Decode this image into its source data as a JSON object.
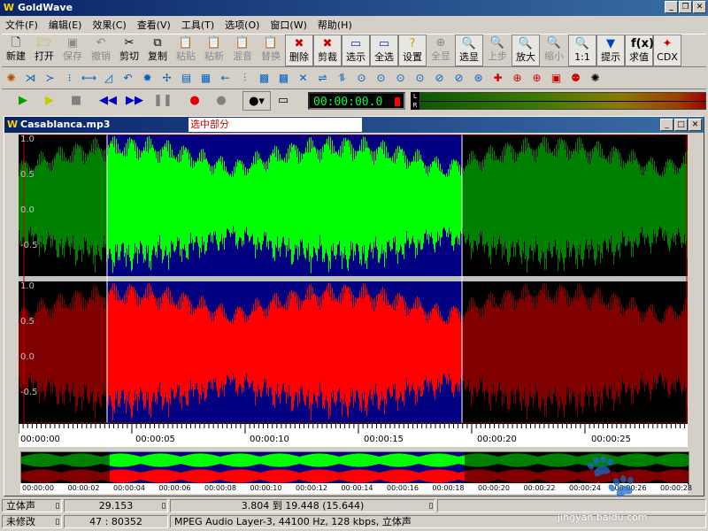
{
  "window": {
    "title": "GoldWave",
    "app_icon": "W"
  },
  "menubar": [
    "文件(F)",
    "编辑(E)",
    "效果(C)",
    "查看(V)",
    "工具(T)",
    "选项(O)",
    "窗口(W)",
    "帮助(H)"
  ],
  "toolbar1": [
    {
      "label": "新建",
      "icon": "new-file-icon",
      "enabled": true
    },
    {
      "label": "打开",
      "icon": "open-folder-icon",
      "enabled": true
    },
    {
      "label": "保存",
      "icon": "save-disk-icon",
      "enabled": false
    },
    {
      "label": "撤销",
      "icon": "undo-arrow-icon",
      "enabled": false
    },
    {
      "label": "剪切",
      "icon": "scissors-icon",
      "enabled": true
    },
    {
      "label": "复制",
      "icon": "copy-icon",
      "enabled": true
    },
    {
      "label": "粘贴",
      "icon": "paste-icon",
      "enabled": false
    },
    {
      "label": "粘新",
      "icon": "paste-new-icon",
      "enabled": false
    },
    {
      "label": "混音",
      "icon": "mix-icon",
      "enabled": false
    },
    {
      "label": "替换",
      "icon": "replace-icon",
      "enabled": false
    },
    {
      "label": "删除",
      "icon": "delete-icon",
      "enabled": true
    },
    {
      "label": "剪裁",
      "icon": "trim-icon",
      "enabled": true
    },
    {
      "label": "选示",
      "icon": "select-view-icon",
      "enabled": true
    },
    {
      "label": "全选",
      "icon": "select-all-icon",
      "enabled": true
    },
    {
      "label": "设置",
      "icon": "settings-icon",
      "enabled": true
    },
    {
      "label": "全显",
      "icon": "show-all-icon",
      "enabled": false
    },
    {
      "label": "选显",
      "icon": "zoom-selection-icon",
      "enabled": true
    },
    {
      "label": "上步",
      "icon": "previous-view-icon",
      "enabled": false
    },
    {
      "label": "放大",
      "icon": "zoom-in-icon",
      "enabled": true
    },
    {
      "label": "缩小",
      "icon": "zoom-out-icon",
      "enabled": false
    },
    {
      "label": "1:1",
      "icon": "zoom-1to1-icon",
      "enabled": true
    },
    {
      "label": "提示",
      "icon": "cue-icon",
      "enabled": true
    },
    {
      "label": "求值",
      "icon": "eval-icon",
      "enabled": true
    },
    {
      "label": "CDX",
      "icon": "cdx-icon",
      "enabled": true
    }
  ],
  "transport": {
    "timer": "00:00:00.0"
  },
  "document": {
    "title": "Casablanca.mp3",
    "selection_annotation": "选中部分",
    "y_labels": [
      "1.0",
      "0.5",
      "0.0",
      "-0.5"
    ],
    "time_labels": [
      "00:00:00",
      "00:00:05",
      "00:00:10",
      "00:00:15",
      "00:00:20",
      "00:00:25"
    ],
    "overview_labels": [
      "00:00:00",
      "00:00:02",
      "00:00:04",
      "00:00:06",
      "00:00:08",
      "00:00:10",
      "00:00:12",
      "00:00:14",
      "00:00:16",
      "00:00:18",
      "00:00:20",
      "00:00:22",
      "00:00:24",
      "00:00:26",
      "00:00:28"
    ]
  },
  "status": {
    "row1": {
      "channels": "立体声",
      "length": "29.153",
      "selection": "3.804 到 19.448 (15.644)"
    },
    "row2": {
      "modified": "未修改",
      "position": "47 : 80352",
      "format": "MPEG Audio Layer-3, 44100 Hz, 128 kbps, 立体声"
    }
  },
  "watermark": {
    "site": "jingyan.baidu.com"
  },
  "colors": {
    "left_channel_selected": "#00ff00",
    "left_channel": "#008000",
    "right_channel_selected": "#ff0000",
    "right_channel": "#800000",
    "background_selected": "#000080",
    "timer_text": "#00ff40",
    "annotation": "#d00000"
  }
}
